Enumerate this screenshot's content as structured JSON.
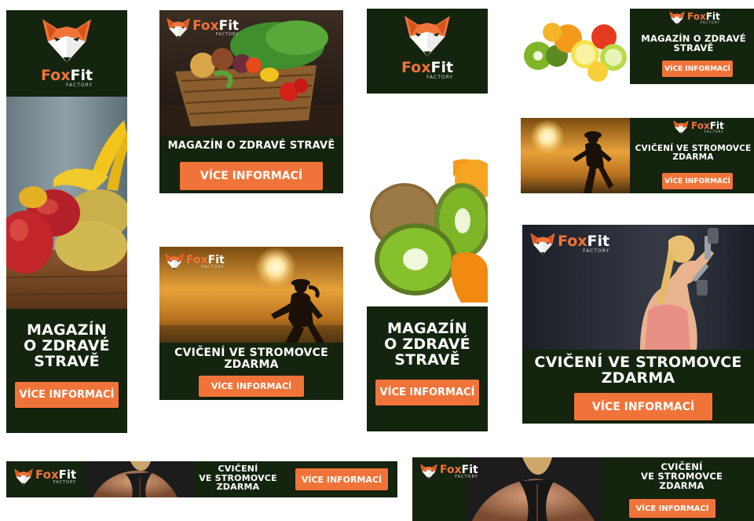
{
  "brand": {
    "word_a": "Fox",
    "word_b": "Fit",
    "sub": "FACTORY",
    "colors": {
      "accent": "#f0743a",
      "panel": "#14240f",
      "fox_dark": "#d6521c",
      "text": "#ffffff"
    }
  },
  "copy": {
    "magazine_single": "MAGAZÍN O ZDRAVÉ STRAVĚ",
    "magazine_two": "MAGAZÍN O ZDRAVÉ\nSTRAVĚ",
    "magazine_three": "MAGAZÍN\nO ZDRAVÉ\nSTRAVĚ",
    "exercise_two": "CVIČENÍ VE STROMOVCE\nZDARMA",
    "exercise_three": "CVIČENÍ\nVE STROMOVCE\nZDARMA",
    "cta": "VÍCE INFORMACÍ"
  },
  "icons": {
    "logo": "fox-head-icon",
    "photos": [
      "fruit-photo",
      "vegetable-basket-photo",
      "citrus-photo",
      "kiwi-orange-photo",
      "runner-sunset-photo",
      "dumbbell-woman-photo",
      "back-muscles-photo"
    ]
  }
}
